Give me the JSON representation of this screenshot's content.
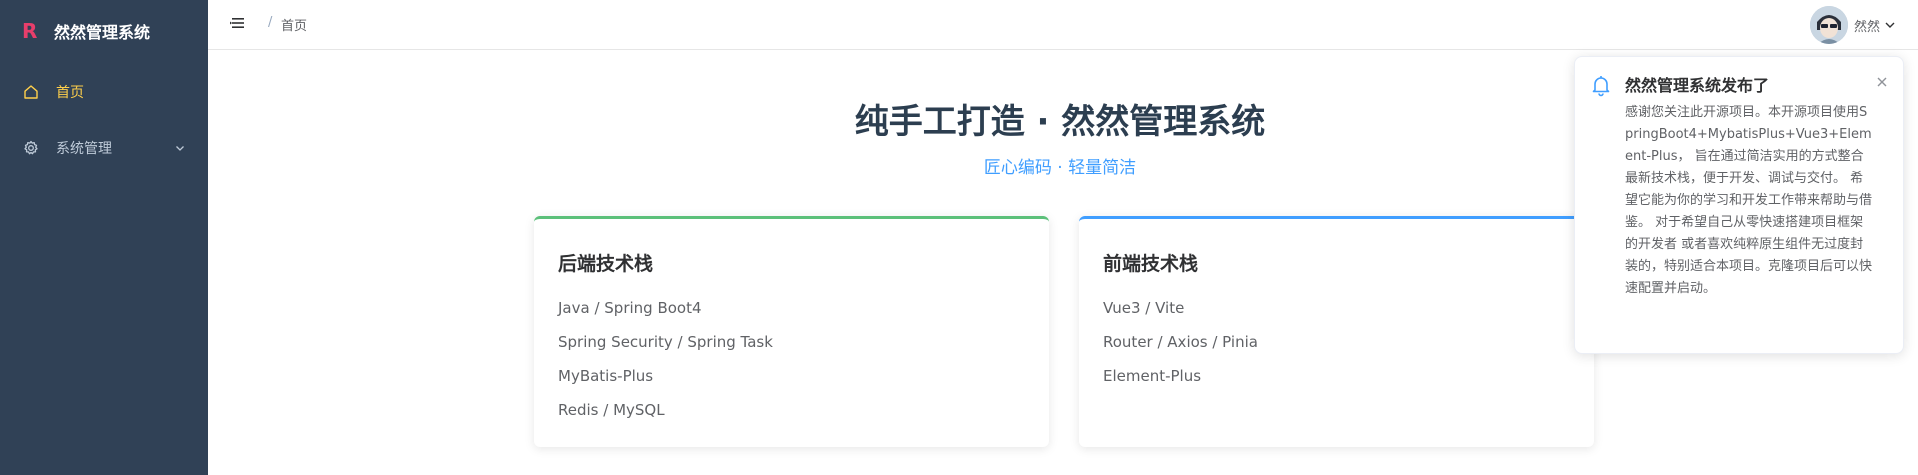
{
  "sidebar": {
    "logo_mark": "R",
    "logo_text": "然然管理系统",
    "items": [
      {
        "label": "首页",
        "icon": "home-icon",
        "active": true
      },
      {
        "label": "系统管理",
        "icon": "gear-icon",
        "expandable": true
      }
    ]
  },
  "header": {
    "breadcrumb_separator": "/",
    "breadcrumb": "首页",
    "username": "然然"
  },
  "main": {
    "title": "纯手工打造 · 然然管理系统",
    "subtitle": "匠心编码 · 轻量简洁",
    "cards": [
      {
        "title": "后端技术栈",
        "items": [
          "Java / Spring Boot4",
          "Spring Security / Spring Task",
          "MyBatis-Plus",
          "Redis / MySQL"
        ]
      },
      {
        "title": "前端技术栈",
        "items": [
          "Vue3 / Vite",
          "Router / Axios / Pinia",
          "Element-Plus"
        ]
      }
    ]
  },
  "notification": {
    "title": "然然管理系统发布了",
    "body": "感谢您关注此开源项目。本开源项目使用SpringBoot4+MybatisPlus+Vue3+Element-Plus， 旨在通过简洁实用的方式整合最新技术栈，便于开发、调试与交付。 希望它能为你的学习和开发工作带来帮助与借鉴。 对于希望自己从零快速搭建项目框架的开发者 或者喜欢纯粹原生组件无过度封装的，特别适合本项目。克隆项目后可以快速配置并启动。"
  },
  "colors": {
    "sidebar_bg": "#304156",
    "active_menu": "#ffd04b",
    "accent": "#409eff",
    "backend_card_accent": "#5cc07a"
  }
}
